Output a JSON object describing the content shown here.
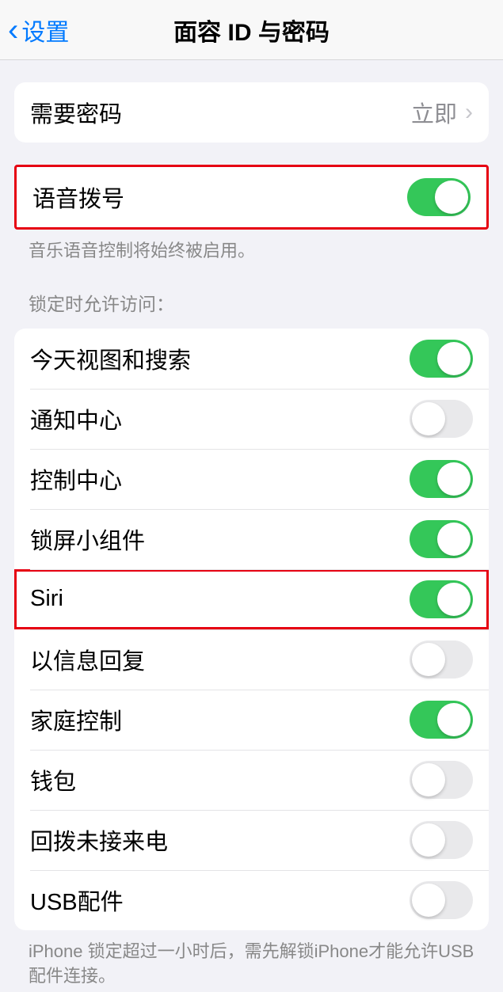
{
  "nav": {
    "back_label": "设置",
    "title": "面容 ID 与密码"
  },
  "passcode_group": {
    "require_passcode_label": "需要密码",
    "require_passcode_value": "立即"
  },
  "voice_dial": {
    "label": "语音拨号",
    "on": true,
    "footer": "音乐语音控制将始终被启用。"
  },
  "lock_section": {
    "header": "锁定时允许访问：",
    "items": [
      {
        "label": "今天视图和搜索",
        "on": true,
        "highlighted": false
      },
      {
        "label": "通知中心",
        "on": false,
        "highlighted": false
      },
      {
        "label": "控制中心",
        "on": true,
        "highlighted": false
      },
      {
        "label": "锁屏小组件",
        "on": true,
        "highlighted": false
      },
      {
        "label": "Siri",
        "on": true,
        "highlighted": true
      },
      {
        "label": "以信息回复",
        "on": false,
        "highlighted": false
      },
      {
        "label": "家庭控制",
        "on": true,
        "highlighted": false
      },
      {
        "label": "钱包",
        "on": false,
        "highlighted": false
      },
      {
        "label": "回拨未接来电",
        "on": false,
        "highlighted": false
      },
      {
        "label": "USB配件",
        "on": false,
        "highlighted": false
      }
    ],
    "footer": "iPhone 锁定超过一小时后，需先解锁iPhone才能允许USB 配件连接。"
  }
}
